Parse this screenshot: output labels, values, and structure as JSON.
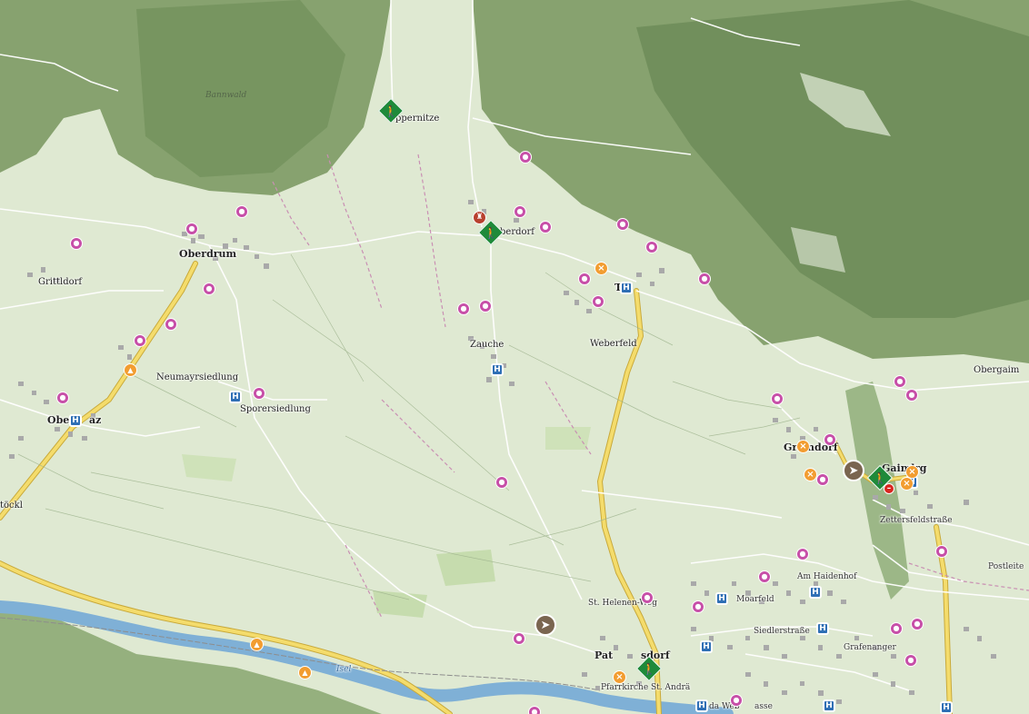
{
  "map": {
    "colors": {
      "meadow": "#dfe9d2",
      "forest": "#86a06e",
      "forest_dark": "#5f7f4c",
      "field_green": "#c6dcae",
      "river": "#7fb0d6",
      "main_road": "#f4dc6c",
      "main_road_casing": "#c8a93a",
      "minor_road": "#ffffff",
      "building": "#a9a9a9",
      "trail": "#c98fb3"
    },
    "places": [
      {
        "name": "Oberdrum",
        "type": "town"
      },
      {
        "name": "Grittldorf",
        "type": "village"
      },
      {
        "name": "Neumayrsiedlung",
        "type": "village"
      },
      {
        "name": "Sporersiedlung",
        "type": "village"
      },
      {
        "name": "Ober",
        "type": "town"
      },
      {
        "name": "az",
        "type": "town"
      },
      {
        "name": "töckl",
        "type": "village"
      },
      {
        "name": "ppernitze",
        "type": "village"
      },
      {
        "name": "berdorf",
        "type": "village"
      },
      {
        "name": "Zauche",
        "type": "village"
      },
      {
        "name": "Th",
        "type": "town"
      },
      {
        "name": "Weberfeld",
        "type": "village"
      },
      {
        "name": "Gr",
        "type": "town"
      },
      {
        "name": "ndorf",
        "type": "town"
      },
      {
        "name": "Gaimb",
        "type": "town"
      },
      {
        "name": "rg",
        "type": "town"
      },
      {
        "name": "Zettersfeldstraße",
        "type": "street"
      },
      {
        "name": "Obergaim",
        "type": "village"
      },
      {
        "name": "Postleite",
        "type": "street"
      },
      {
        "name": "Am Haidenhof",
        "type": "street"
      },
      {
        "name": "Moarfeld",
        "type": "street"
      },
      {
        "name": "Siedlerstraße",
        "type": "street"
      },
      {
        "name": "Grafenanger",
        "type": "street"
      },
      {
        "name": "St. Helenen-Weg",
        "type": "street"
      },
      {
        "name": "Pat",
        "type": "town"
      },
      {
        "name": "sdorf",
        "type": "town"
      },
      {
        "name": "Pfarrkirche St. Andrä",
        "type": "street"
      },
      {
        "name": "da Web",
        "type": "street"
      },
      {
        "name": "asse",
        "type": "street"
      },
      {
        "name": "Bannwald",
        "type": "forest"
      },
      {
        "name": "Isel",
        "type": "river"
      }
    ],
    "pois": [
      {
        "type": "hike",
        "icon": "hiking-icon"
      },
      {
        "type": "hike",
        "icon": "hiking-icon"
      },
      {
        "type": "hike",
        "icon": "hiking-icon"
      },
      {
        "type": "hike",
        "icon": "hiking-icon"
      },
      {
        "type": "guidepost",
        "icon": "signpost-icon"
      },
      {
        "type": "guidepost",
        "icon": "signpost-icon"
      },
      {
        "type": "bus",
        "icon": "bus-stop-icon"
      },
      {
        "type": "bus",
        "icon": "bus-stop-icon"
      },
      {
        "type": "bus",
        "icon": "bus-stop-icon"
      },
      {
        "type": "bus",
        "icon": "bus-stop-icon"
      },
      {
        "type": "bus",
        "icon": "bus-stop-icon"
      },
      {
        "type": "bus",
        "icon": "bus-stop-icon"
      },
      {
        "type": "bus",
        "icon": "bus-stop-icon"
      },
      {
        "type": "bus",
        "icon": "bus-stop-icon"
      },
      {
        "type": "bus",
        "icon": "bus-stop-icon"
      },
      {
        "type": "bus",
        "icon": "bus-stop-icon"
      },
      {
        "type": "bus",
        "icon": "bus-stop-icon"
      },
      {
        "type": "bus",
        "icon": "bus-stop-icon"
      },
      {
        "type": "food",
        "icon": "restaurant-icon"
      },
      {
        "type": "food",
        "icon": "restaurant-icon"
      },
      {
        "type": "food",
        "icon": "restaurant-icon"
      },
      {
        "type": "food",
        "icon": "restaurant-icon"
      },
      {
        "type": "food",
        "icon": "restaurant-icon"
      },
      {
        "type": "food",
        "icon": "restaurant-icon"
      },
      {
        "type": "camp",
        "icon": "camping-icon"
      },
      {
        "type": "camp",
        "icon": "camping-icon"
      },
      {
        "type": "camp",
        "icon": "camping-icon"
      },
      {
        "type": "sight",
        "icon": "landmark-icon"
      },
      {
        "type": "noentry",
        "icon": "no-entry-icon"
      },
      {
        "type": "lodging",
        "icon": "accommodation-icon"
      },
      {
        "type": "lodging",
        "icon": "accommodation-icon"
      },
      {
        "type": "lodging",
        "icon": "accommodation-icon"
      },
      {
        "type": "lodging",
        "icon": "accommodation-icon"
      },
      {
        "type": "lodging",
        "icon": "accommodation-icon"
      },
      {
        "type": "lodging",
        "icon": "accommodation-icon"
      },
      {
        "type": "lodging",
        "icon": "accommodation-icon"
      },
      {
        "type": "lodging",
        "icon": "accommodation-icon"
      },
      {
        "type": "lodging",
        "icon": "accommodation-icon"
      },
      {
        "type": "lodging",
        "icon": "accommodation-icon"
      },
      {
        "type": "lodging",
        "icon": "accommodation-icon"
      },
      {
        "type": "lodging",
        "icon": "accommodation-icon"
      },
      {
        "type": "lodging",
        "icon": "accommodation-icon"
      },
      {
        "type": "lodging",
        "icon": "accommodation-icon"
      },
      {
        "type": "lodging",
        "icon": "accommodation-icon"
      },
      {
        "type": "lodging",
        "icon": "accommodation-icon"
      },
      {
        "type": "lodging",
        "icon": "accommodation-icon"
      },
      {
        "type": "lodging",
        "icon": "accommodation-icon"
      },
      {
        "type": "lodging",
        "icon": "accommodation-icon"
      },
      {
        "type": "lodging",
        "icon": "accommodation-icon"
      },
      {
        "type": "lodging",
        "icon": "accommodation-icon"
      },
      {
        "type": "lodging",
        "icon": "accommodation-icon"
      },
      {
        "type": "lodging",
        "icon": "accommodation-icon"
      },
      {
        "type": "lodging",
        "icon": "accommodation-icon"
      },
      {
        "type": "lodging",
        "icon": "accommodation-icon"
      },
      {
        "type": "lodging",
        "icon": "accommodation-icon"
      },
      {
        "type": "lodging",
        "icon": "accommodation-icon"
      },
      {
        "type": "lodging",
        "icon": "accommodation-icon"
      },
      {
        "type": "lodging",
        "icon": "accommodation-icon"
      },
      {
        "type": "lodging",
        "icon": "accommodation-icon"
      },
      {
        "type": "lodging",
        "icon": "accommodation-icon"
      },
      {
        "type": "lodging",
        "icon": "accommodation-icon"
      }
    ]
  }
}
